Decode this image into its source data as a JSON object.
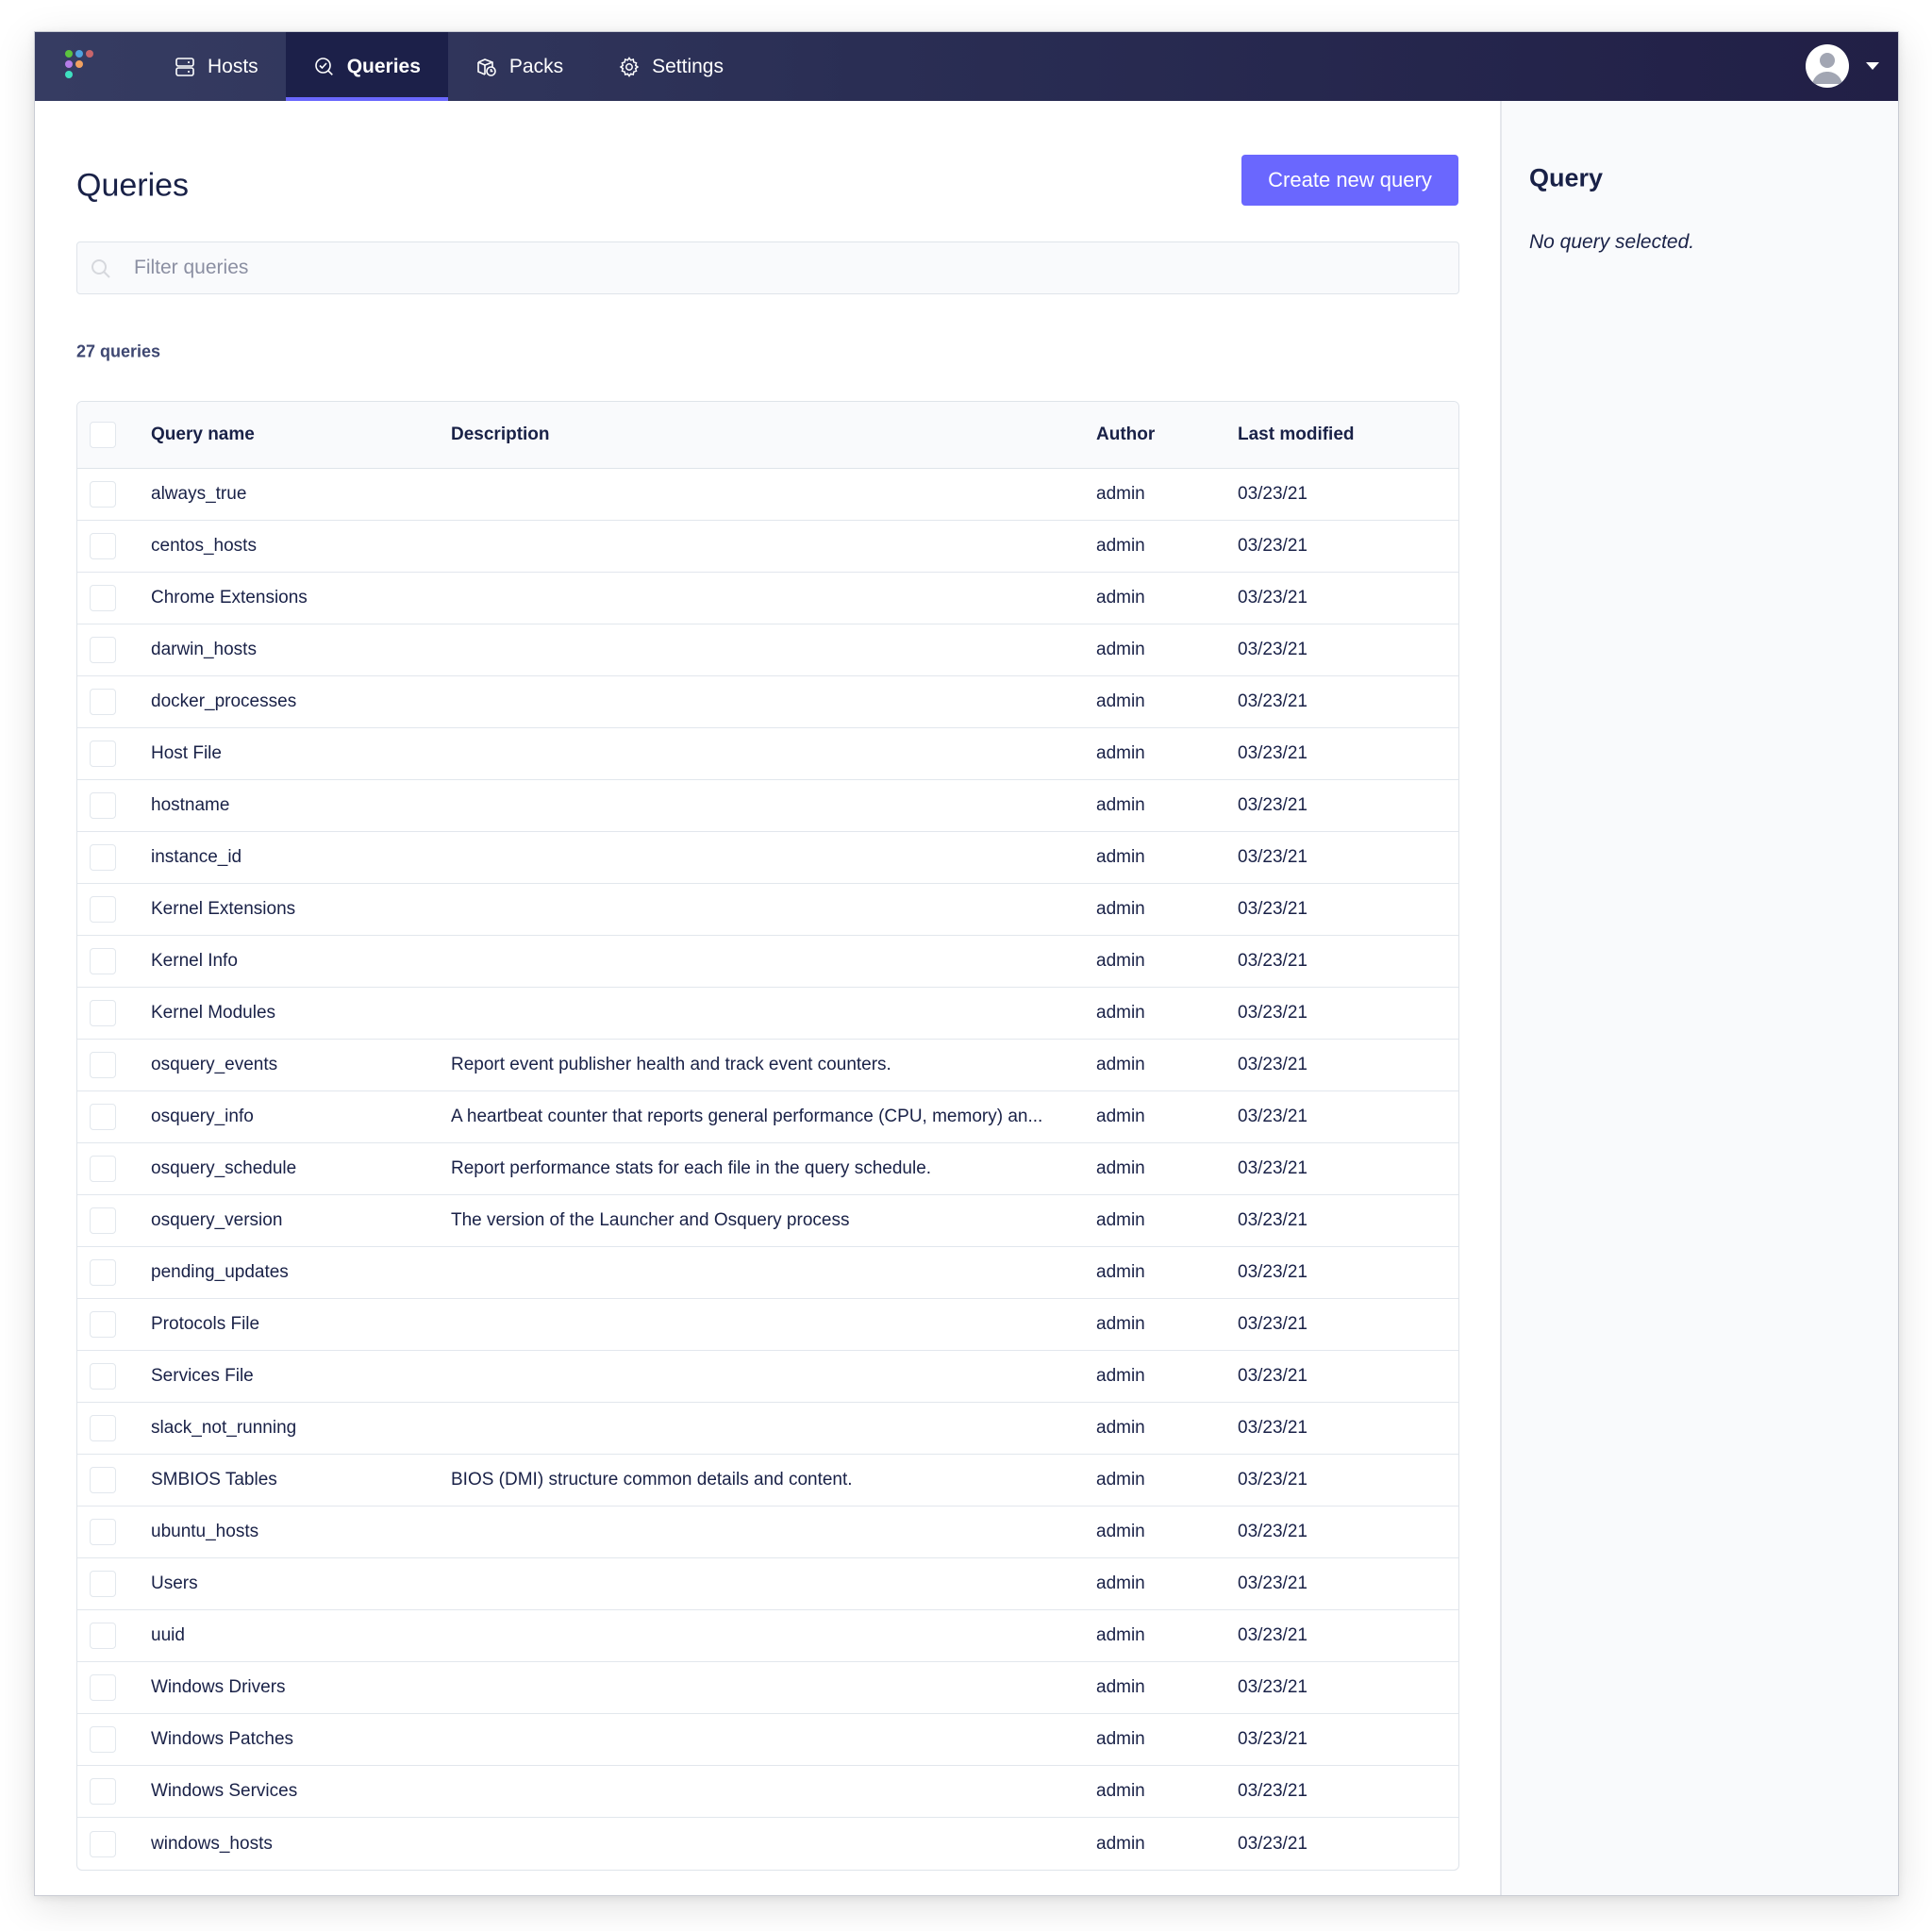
{
  "nav": {
    "items": [
      {
        "label": "Hosts",
        "icon": "hosts-icon",
        "active": false
      },
      {
        "label": "Queries",
        "icon": "queries-icon",
        "active": true
      },
      {
        "label": "Packs",
        "icon": "packs-icon",
        "active": false
      },
      {
        "label": "Settings",
        "icon": "gear-icon",
        "active": false
      }
    ],
    "logo_colors": [
      "#5cc33e",
      "#4fa3e0",
      "#c8656b",
      "#b57de8",
      "#f1a161",
      "#3fe0c0"
    ],
    "accent": "#6a67fe"
  },
  "page": {
    "title": "Queries",
    "create_button": "Create new query",
    "filter_placeholder": "Filter queries",
    "filter_value": "",
    "count_label": "27 queries"
  },
  "table": {
    "headers": {
      "name": "Query name",
      "description": "Description",
      "author": "Author",
      "modified": "Last modified"
    },
    "rows": [
      {
        "name": "always_true",
        "description": "",
        "author": "admin",
        "modified": "03/23/21"
      },
      {
        "name": "centos_hosts",
        "description": "",
        "author": "admin",
        "modified": "03/23/21"
      },
      {
        "name": "Chrome Extensions",
        "description": "",
        "author": "admin",
        "modified": "03/23/21"
      },
      {
        "name": "darwin_hosts",
        "description": "",
        "author": "admin",
        "modified": "03/23/21"
      },
      {
        "name": "docker_processes",
        "description": "",
        "author": "admin",
        "modified": "03/23/21"
      },
      {
        "name": "Host File",
        "description": "",
        "author": "admin",
        "modified": "03/23/21"
      },
      {
        "name": "hostname",
        "description": "",
        "author": "admin",
        "modified": "03/23/21"
      },
      {
        "name": "instance_id",
        "description": "",
        "author": "admin",
        "modified": "03/23/21"
      },
      {
        "name": "Kernel Extensions",
        "description": "",
        "author": "admin",
        "modified": "03/23/21"
      },
      {
        "name": "Kernel Info",
        "description": "",
        "author": "admin",
        "modified": "03/23/21"
      },
      {
        "name": "Kernel Modules",
        "description": "",
        "author": "admin",
        "modified": "03/23/21"
      },
      {
        "name": "osquery_events",
        "description": "Report event publisher health and track event counters.",
        "author": "admin",
        "modified": "03/23/21"
      },
      {
        "name": "osquery_info",
        "description": "A heartbeat counter that reports general performance (CPU, memory) an...",
        "author": "admin",
        "modified": "03/23/21"
      },
      {
        "name": "osquery_schedule",
        "description": "Report performance stats for each file in the query schedule.",
        "author": "admin",
        "modified": "03/23/21"
      },
      {
        "name": "osquery_version",
        "description": "The version of the Launcher and Osquery process",
        "author": "admin",
        "modified": "03/23/21"
      },
      {
        "name": "pending_updates",
        "description": "",
        "author": "admin",
        "modified": "03/23/21"
      },
      {
        "name": "Protocols File",
        "description": "",
        "author": "admin",
        "modified": "03/23/21"
      },
      {
        "name": "Services File",
        "description": "",
        "author": "admin",
        "modified": "03/23/21"
      },
      {
        "name": "slack_not_running",
        "description": "",
        "author": "admin",
        "modified": "03/23/21"
      },
      {
        "name": "SMBIOS Tables",
        "description": "BIOS (DMI) structure common details and content.",
        "author": "admin",
        "modified": "03/23/21"
      },
      {
        "name": "ubuntu_hosts",
        "description": "",
        "author": "admin",
        "modified": "03/23/21"
      },
      {
        "name": "Users",
        "description": "",
        "author": "admin",
        "modified": "03/23/21"
      },
      {
        "name": "uuid",
        "description": "",
        "author": "admin",
        "modified": "03/23/21"
      },
      {
        "name": "Windows Drivers",
        "description": "",
        "author": "admin",
        "modified": "03/23/21"
      },
      {
        "name": "Windows Patches",
        "description": "",
        "author": "admin",
        "modified": "03/23/21"
      },
      {
        "name": "Windows Services",
        "description": "",
        "author": "admin",
        "modified": "03/23/21"
      },
      {
        "name": "windows_hosts",
        "description": "",
        "author": "admin",
        "modified": "03/23/21"
      }
    ]
  },
  "sidebar": {
    "title": "Query",
    "empty_message": "No query selected."
  }
}
